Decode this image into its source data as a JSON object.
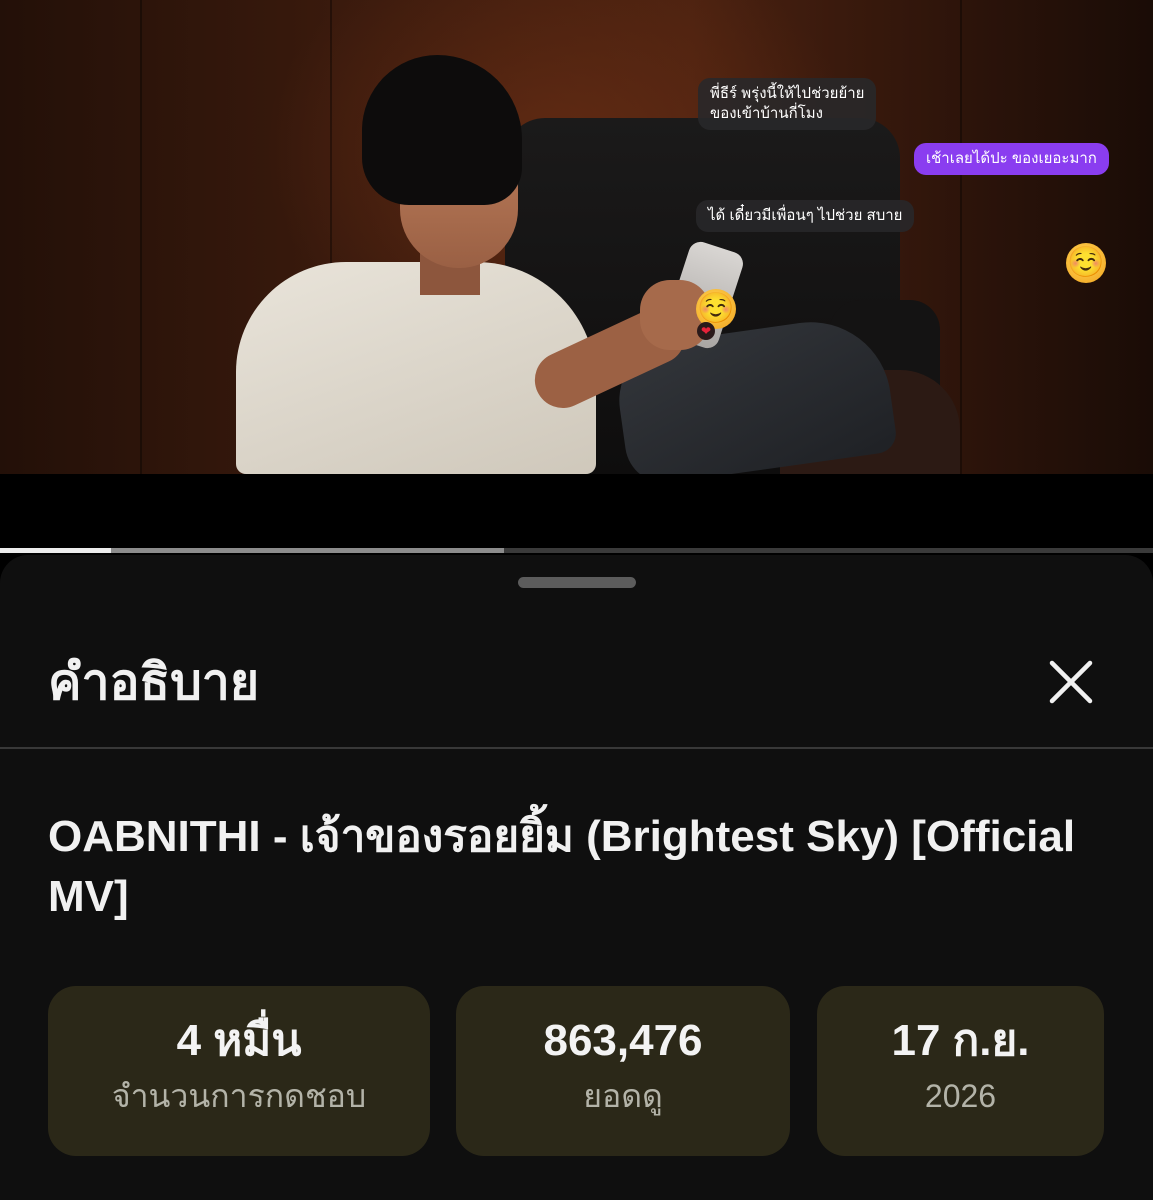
{
  "video": {
    "chat_bubbles": [
      {
        "text": "พี่ธีร์ พรุ่งนี้ให้ไปช่วยย้าย\nของเข้าบ้านกี่โมง",
        "style": "gray"
      },
      {
        "text": "เช้าเลยได้ปะ ของเยอะมาก",
        "style": "purple"
      },
      {
        "text": "ได้ เดี๋ยวมีเพื่อนๆ ไปช่วย สบาย",
        "style": "gray"
      }
    ],
    "emojis": [
      "☺️",
      "☺️"
    ],
    "heart": "❤"
  },
  "progress": {
    "played_fraction": 0.096,
    "buffered_fraction": 0.437
  },
  "sheet": {
    "title": "คำอธิบาย",
    "close_icon": "close-icon",
    "video_title": "OABNITHI - เจ้าของรอยยิ้ม (Brightest Sky) [Official MV]",
    "stats": [
      {
        "value": "4 หมื่น",
        "label": "จำนวนการกดชอบ"
      },
      {
        "value": "863,476",
        "label": "ยอดดู"
      },
      {
        "value": "17 ก.ย.",
        "label": "2026"
      }
    ]
  },
  "colors": {
    "sheet_bg": "#0f0f0f",
    "stat_bg": "#2b2818",
    "bubble_purple": "#8a3df0",
    "progress_played": "#ececec"
  }
}
